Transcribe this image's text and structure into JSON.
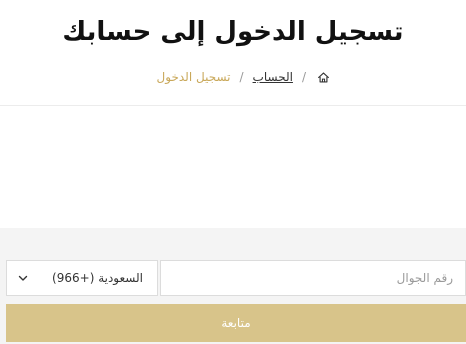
{
  "header": {
    "title": "تسجيل الدخول إلى حسابك",
    "breadcrumb": {
      "home_icon": "home-icon",
      "separator": "/",
      "account_link": "الحساب",
      "current": "تسجيل الدخول"
    }
  },
  "form": {
    "phone": {
      "placeholder": "رقم الجوال",
      "value": ""
    },
    "country": {
      "selected": "السعودية (+966)",
      "icon": "chevron-down-icon"
    },
    "submit_label": "متابعة"
  },
  "colors": {
    "accent": "#c9a85a",
    "button": "#d8c48a",
    "form_background": "#f4f4f4"
  }
}
